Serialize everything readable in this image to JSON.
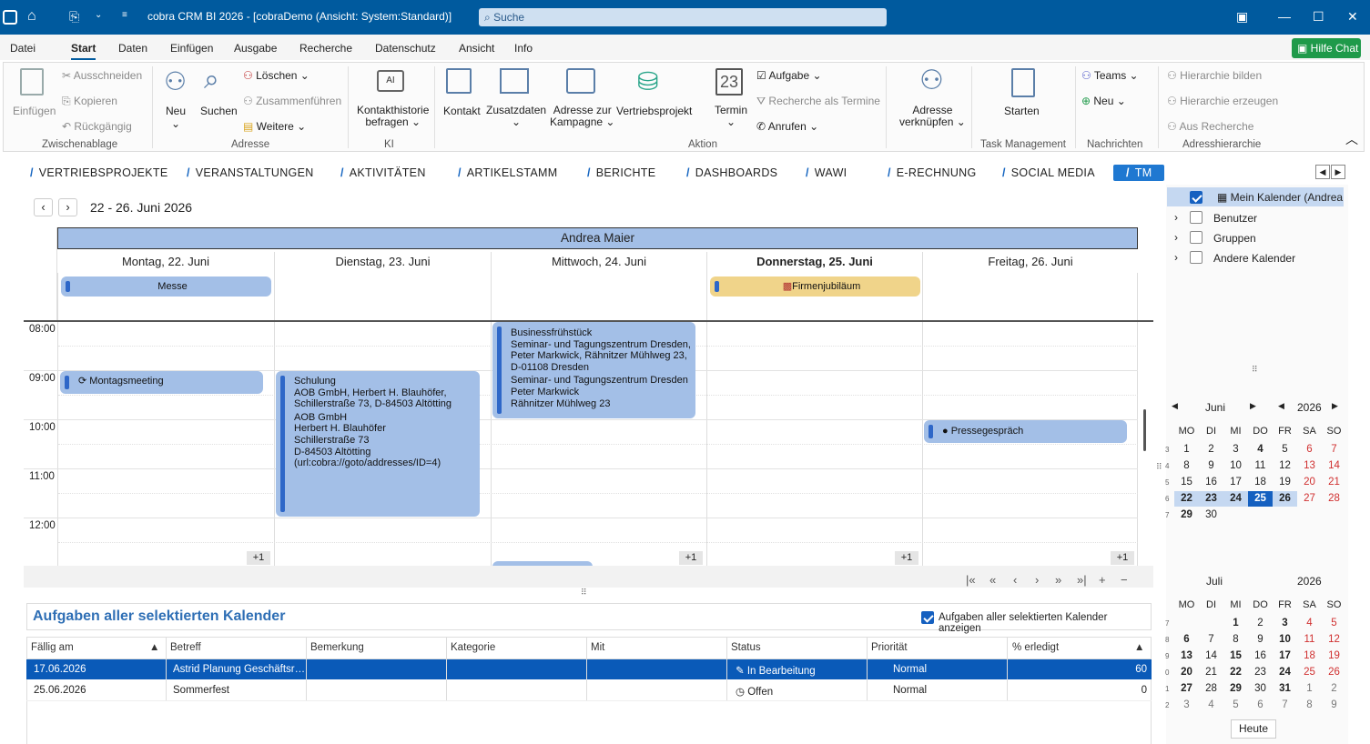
{
  "titlebar": {
    "title": "cobra CRM BI 2026 - [cobraDemo (Ansicht: System:Standard)]",
    "search_placeholder": "Suche"
  },
  "menu": {
    "items": [
      "Datei",
      "Start",
      "Daten",
      "Einfügen",
      "Ausgabe",
      "Recherche",
      "Datenschutz",
      "Ansicht",
      "Info"
    ],
    "active": "Start",
    "help_label": "Hilfe Chat"
  },
  "ribbon": {
    "clipboard": {
      "paste": "Einfügen",
      "cut": "Ausschneiden",
      "copy": "Kopieren",
      "undo": "Rückgängig",
      "group": "Zwischenablage"
    },
    "address": {
      "new": "Neu",
      "search": "Suchen",
      "delete": "Löschen",
      "merge": "Zusammenführen",
      "more": "Weitere",
      "group": "Adresse"
    },
    "ki": {
      "history_line1": "Kontakthistorie",
      "history_line2": "befragen",
      "group": "KI"
    },
    "action": {
      "contact": "Kontakt",
      "extra": "Zusatzdaten",
      "campaign_line1": "Adresse zur",
      "campaign_line2": "Kampagne",
      "project": "Vertriebsprojekt",
      "appointment": "Termin",
      "appointment_day": "23",
      "task": "Aufgabe",
      "research_dates": "Recherche als Termine",
      "call": "Anrufen",
      "group": "Aktion"
    },
    "link": {
      "line1": "Adresse",
      "line2": "verknüpfen"
    },
    "taskmgmt": {
      "start": "Starten",
      "group": "Task Management"
    },
    "news": {
      "teams": "Teams",
      "new": "Neu",
      "group": "Nachrichten"
    },
    "hierarchy": {
      "build": "Hierarchie bilden",
      "create": "Hierarchie erzeugen",
      "from_research": "Aus Recherche",
      "group": "Adresshierarchie"
    }
  },
  "tabs": [
    "VERTRIEBSPROJEKTE",
    "VERANSTALTUNGEN",
    "AKTIVITÄTEN",
    "ARTIKELSTAMM",
    "BERICHTE",
    "DASHBOARDS",
    "WAWI",
    "E-RECHNUNG",
    "SOCIAL MEDIA",
    "TM"
  ],
  "calendar": {
    "range": "22 - 26. Juni 2026",
    "owner": "Andrea Maier",
    "days": [
      "Montag, 22. Juni",
      "Dienstag, 23. Juni",
      "Mittwoch, 24. Juni",
      "Donnerstag, 25. Juni",
      "Freitag, 26. Juni"
    ],
    "times": [
      "08:00",
      "09:00",
      "10:00",
      "11:00",
      "12:00"
    ],
    "allday": {
      "messe": "Messe",
      "jubilaeum": "Firmenjubiläum"
    },
    "events": {
      "montag": "Montagsmeeting",
      "schulung": [
        "Schulung",
        "AOB GmbH, Herbert H. Blauhöfer,",
        "Schillerstraße 73, D-84503 Altötting",
        "AOB GmbH",
        "Herbert H. Blauhöfer",
        "Schillerstraße 73",
        "D-84503 Altötting",
        "(url:cobra://goto/addresses/ID=4)"
      ],
      "fruehstueck": [
        "Businessfrühstück",
        "Seminar- und Tagungszentrum Dresden,",
        "Peter Markwick, Rähnitzer Mühlweg 23,",
        "D-01108 Dresden",
        "Seminar- und Tagungszentrum Dresden",
        "Peter Markwick",
        "Rähnitzer Mühlweg 23"
      ],
      "presse": "Pressegespräch"
    },
    "more_label": "+1"
  },
  "tasks": {
    "title": "Aufgaben aller selektierten Kalender",
    "show_all_label": "Aufgaben aller selektierten Kalender anzeigen",
    "columns": [
      "Fällig am",
      "Betreff",
      "Bemerkung",
      "Kategorie",
      "Mit",
      "Status",
      "Priorität",
      "% erledigt"
    ],
    "rows": [
      {
        "due": "17.06.2026",
        "subject": "Astrid Planung Geschäftsr…",
        "status": "In Bearbeitung",
        "priority": "Normal",
        "done": "60"
      },
      {
        "due": "25.06.2026",
        "subject": "Sommerfest",
        "status": "Offen",
        "priority": "Normal",
        "done": "0"
      }
    ]
  },
  "sidepanel": {
    "items": [
      "Mein Kalender (Andrea M",
      "Benutzer",
      "Gruppen",
      "Andere Kalender"
    ],
    "month1": {
      "month": "Juni",
      "year": "2026"
    },
    "month2": {
      "month": "Juli",
      "year": "2026"
    },
    "weekdays": [
      "MO",
      "DI",
      "MI",
      "DO",
      "FR",
      "SA",
      "SO"
    ],
    "today_button": "Heute"
  }
}
